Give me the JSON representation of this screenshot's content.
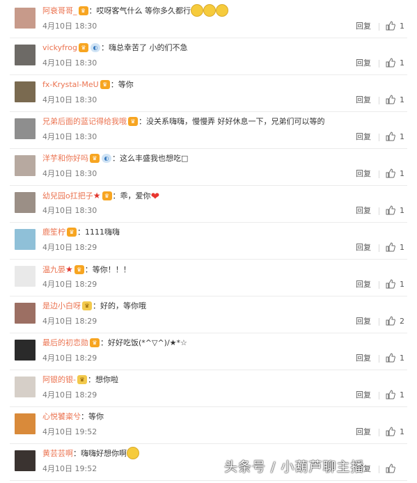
{
  "reply_label": "回复",
  "comments": [
    {
      "user": "阿衰哥哥_",
      "avatar_color": "#c79a8a",
      "badges": [
        "vip"
      ],
      "text": "：哎呀客气什么 等你多久都行",
      "emojis": 3,
      "heart": false,
      "time": "4月10日 18:30",
      "likes": "1"
    },
    {
      "user": "vickyfrog",
      "avatar_color": "#6d6a66",
      "badges": [
        "vip",
        "ring"
      ],
      "text": "：嗨总幸苦了 小的们不急",
      "emojis": 0,
      "heart": false,
      "time": "4月10日 18:30",
      "likes": "1"
    },
    {
      "user": "fx-Krystal-MeU",
      "avatar_color": "#7a6a50",
      "badges": [
        "vip"
      ],
      "text": "：等你",
      "emojis": 0,
      "heart": false,
      "time": "4月10日 18:30",
      "likes": "1"
    },
    {
      "user": "兄弟后面的蓝记得给我哦",
      "avatar_color": "#8e8e8e",
      "badges": [
        "vip"
      ],
      "text": "：没关系嗨嗨，慢慢弄 好好休息一下，兄弟们可以等的",
      "emojis": 0,
      "heart": false,
      "time": "4月10日 18:30",
      "likes": "1"
    },
    {
      "user": "洋芋和你好吗",
      "avatar_color": "#b7a9a0",
      "badges": [
        "vip",
        "ring"
      ],
      "text": "：这么丰盛我也想吃□",
      "emojis": 0,
      "heart": false,
      "time": "4月10日 18:30",
      "likes": "1"
    },
    {
      "user": "幼兒园o扛把子",
      "avatar_color": "#9b8f86",
      "badges": [
        "star",
        "vip"
      ],
      "text": "：乖，爱你",
      "emojis": 0,
      "heart": true,
      "time": "4月10日 18:30",
      "likes": "1"
    },
    {
      "user": "鹿笙柠",
      "avatar_color": "#8fc0d8",
      "badges": [
        "vip"
      ],
      "text": "：1111嗨嗨",
      "emojis": 0,
      "heart": false,
      "time": "4月10日 18:29",
      "likes": "1"
    },
    {
      "user": "温九晏",
      "avatar_color": "#e9e9e9",
      "badges": [
        "star",
        "vip"
      ],
      "text": "：等你！！！",
      "emojis": 0,
      "heart": false,
      "time": "4月10日 18:29",
      "likes": "1"
    },
    {
      "user": "是边小白呀",
      "avatar_color": "#9c6f63",
      "badges": [
        "gold"
      ],
      "text": "：好的，等你哦",
      "emojis": 0,
      "heart": false,
      "time": "4月10日 18:29",
      "likes": "2"
    },
    {
      "user": "最后的初恋勋",
      "avatar_color": "#2a2a2a",
      "badges": [
        "vip"
      ],
      "text": "：好好吃饭(*^▽^)/★*☆",
      "emojis": 0,
      "heart": false,
      "time": "4月10日 18:29",
      "likes": "1"
    },
    {
      "user": "阿银的银-",
      "avatar_color": "#d6cfc8",
      "badges": [
        "gold"
      ],
      "text": "：想你啦",
      "emojis": 0,
      "heart": false,
      "time": "4月10日 18:29",
      "likes": "1"
    },
    {
      "user": "心悦饕粢兮",
      "avatar_color": "#d98a3a",
      "badges": [],
      "text": "：等你",
      "emojis": 0,
      "heart": false,
      "time": "4月10日 19:52",
      "likes": "1"
    },
    {
      "user": "黄芸芸啊",
      "avatar_color": "#3a3330",
      "badges": [],
      "text": "：嗨嗨好想你啊",
      "emojis": 1,
      "heart": false,
      "time": "4月10日 19:52",
      "likes": ""
    }
  ],
  "watermark": "头条号 / 小葫芦聊主播"
}
